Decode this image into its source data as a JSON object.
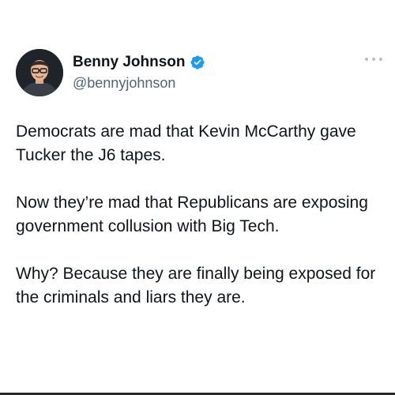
{
  "author": {
    "display_name": "Benny Johnson",
    "handle": "@bennyjohnson",
    "verified": true,
    "avatar_icon": "profile-photo"
  },
  "tweet": {
    "paragraphs": [
      "Democrats are mad that Kevin McCarthy gave Tucker the J6 tapes.",
      "Now they’re mad that Republicans are exposing government collusion with Big Tech.",
      "Why? Because they are finally being exposed for the criminals and liars they are."
    ]
  },
  "colors": {
    "verified_badge": "#1d9bf0",
    "text_primary": "#0f1419",
    "text_secondary": "#536471"
  }
}
